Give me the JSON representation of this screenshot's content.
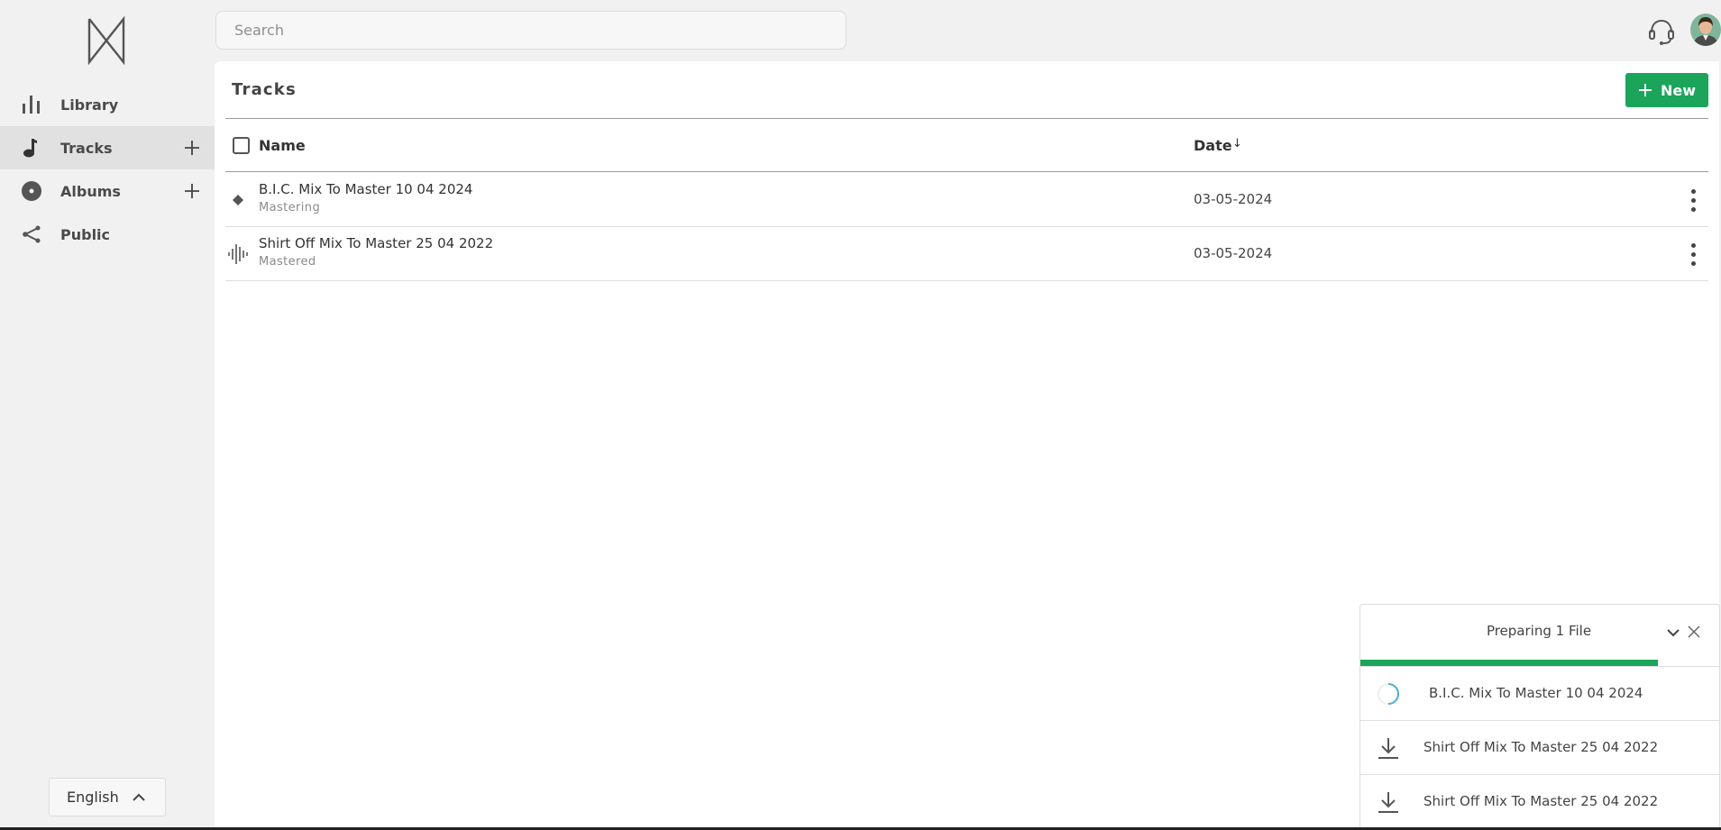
{
  "sidebar": {
    "items": [
      {
        "label": "Library",
        "icon": "bar-chart-icon"
      },
      {
        "label": "Tracks",
        "icon": "music-note-icon",
        "active": true
      },
      {
        "label": "Albums",
        "icon": "disc-icon"
      },
      {
        "label": "Public",
        "icon": "share-icon"
      }
    ],
    "language": "English"
  },
  "search": {
    "placeholder": "Search"
  },
  "main": {
    "title": "Tracks",
    "new_label": "New",
    "columns": {
      "name": "Name",
      "date": "Date",
      "sort_indicator": "↓"
    },
    "rows": [
      {
        "name": "B.I.C. Mix To Master 10 04 2024",
        "status": "Mastering",
        "date": "03-05-2024",
        "icon": "diamond-icon"
      },
      {
        "name": "Shirt Off Mix To Master 25 04 2022",
        "status": "Mastered",
        "date": "03-05-2024",
        "icon": "waveform-icon"
      }
    ]
  },
  "downloads": {
    "title": "Preparing 1 File",
    "progress": 0.83,
    "items": [
      {
        "name": "B.I.C. Mix To Master 10 04 2024",
        "icon": "spinner-icon"
      },
      {
        "name": "Shirt Off Mix To Master 25 04 2022",
        "icon": "download-icon"
      },
      {
        "name": "Shirt Off Mix To Master 25 04 2022",
        "icon": "download-icon"
      }
    ]
  },
  "colors": {
    "accent": "#1aa55b",
    "background": "#f1f1f1",
    "panel": "#ffffff"
  }
}
